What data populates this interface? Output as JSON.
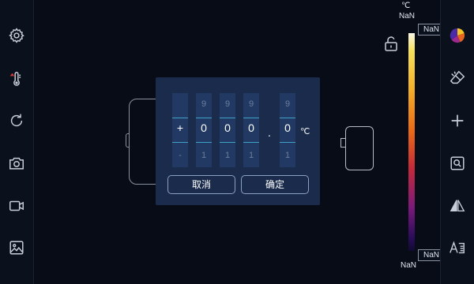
{
  "sidebar_left": {
    "items": [
      {
        "name": "settings-icon"
      },
      {
        "name": "thermometer-icon"
      },
      {
        "name": "rotate-icon"
      },
      {
        "name": "camera-icon"
      },
      {
        "name": "video-icon"
      },
      {
        "name": "gallery-icon"
      }
    ]
  },
  "sidebar_right": {
    "items": [
      {
        "name": "palette-icon"
      },
      {
        "name": "eraser-icon"
      },
      {
        "name": "plus-icon"
      },
      {
        "name": "zoom-icon"
      },
      {
        "name": "mirror-icon"
      },
      {
        "name": "text-edit-icon"
      }
    ]
  },
  "scale": {
    "unit": "℃",
    "max_label": "NaN",
    "min_label": "NaN",
    "max_tag": "NaN",
    "min_tag": "NaN"
  },
  "dialog": {
    "columns": [
      {
        "top": "",
        "value": "+",
        "bottom": "-"
      },
      {
        "top": "9",
        "value": "0",
        "bottom": "1"
      },
      {
        "top": "9",
        "value": "0",
        "bottom": "1"
      },
      {
        "top": "9",
        "value": "0",
        "bottom": "1"
      },
      {
        "top": "9",
        "value": "0",
        "bottom": "1"
      }
    ],
    "decimal_point": ".",
    "unit": "℃",
    "cancel_label": "取消",
    "confirm_label": "确定"
  },
  "colors": {
    "background": "#060b14",
    "dialog_bg": "#1a2b4c",
    "column_bg": "#223a63",
    "accent_line": "#3fa1c6"
  }
}
